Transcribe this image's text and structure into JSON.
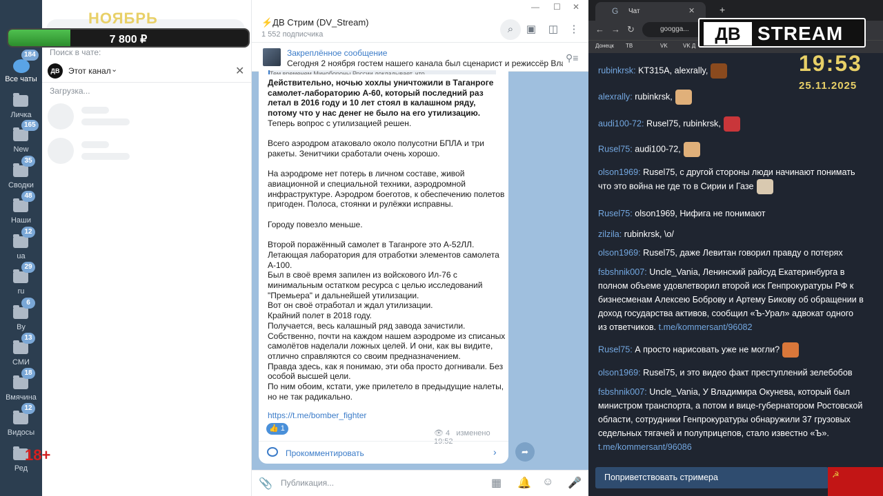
{
  "overlay": {
    "month": "НОЯБРЬ",
    "money": "7 800 ₽",
    "money_progress": 0.26,
    "age": "18+"
  },
  "rail": [
    {
      "label": "Все чаты",
      "badge": "184"
    },
    {
      "label": "Личка",
      "badge": ""
    },
    {
      "label": "New",
      "badge": "165"
    },
    {
      "label": "Сводки",
      "badge": "35"
    },
    {
      "label": "Наши",
      "badge": "48"
    },
    {
      "label": "ua",
      "badge": "12"
    },
    {
      "label": "ru",
      "badge": "29"
    },
    {
      "label": "By",
      "badge": "6"
    },
    {
      "label": "СМИ",
      "badge": "13"
    },
    {
      "label": "Вмячина",
      "badge": "18"
    },
    {
      "label": "Видосы",
      "badge": "12"
    },
    {
      "label": "Ред",
      "badge": ""
    }
  ],
  "chatlist": {
    "search_label": "Поиск в чате:",
    "channel_name": "Этот канал",
    "channel_avatar": "ДВ",
    "loading": "Загрузка..."
  },
  "header": {
    "title": "⚡ДВ Стрим (DV_Stream)",
    "subscribers": "1 552 подписчика"
  },
  "pinned": {
    "title": "Закреплённое сообщение",
    "text": "Сегодня 2 ноября гостем нашего канала был сценарист и режиссёр Вла..."
  },
  "message": {
    "reply_preview": "Тем временем Минобороны России докладывает, что ...",
    "bold": "Действительно, ночью хохлы уничтожили в Таганроге самолет-лабораторию А-60, который последний раз летал в 2016 году и 10 лет стоял в калашном ряду, потому что у нас денег не было на его утилизацию.",
    "body": "\nТеперь вопрос с утилизацией решен.\n\nВсего аэродром атаковало около полусотни БПЛА и три ракеты. Зенитчики сработали очень хорошо.\n\nНа аэродроме нет потерь в личном составе, живой авиационной и специальной техники, аэродромной инфраструктуре. Аэродром боеготов, к обеспечению полетов пригоден. Полоса, стоянки и рулёжки исправны.\n\nГороду повезло меньше.\n\nВторой поражённый самолет в Таганроге это А-52ЛЛ. Летающая лаборатория для отработки элементов самолета А-100.\nБыл в своё время запилен из войскового Ил-76 с минимальным остатком ресурса с целью исследований \"Премьера\" и дальнейшей утилизации.\nВот он своё отработал и ждал утилизации.\nКрайний полет в 2018 году.\nПолучается, весь калашный ряд завода зачистили.\nСобственно, почти на каждом нашем аэродроме из списаных самолётов наделали ложных целей. И они, как вы видите, отлично справляются со своим предназначением.\nПравда здесь, как я понимаю, эти оба просто догнивали. Без особой высшей цели.\nПо ним обоим, кстати, уже прилетело в предыдущие налеты, но не так радикально.",
    "link": "https://t.me/bomber_fighter",
    "reaction": "👍 1",
    "views": "4",
    "edited": "изменено 19:52",
    "comment": "Прокомментировать"
  },
  "composer": {
    "placeholder": "Публикация..."
  },
  "browser": {
    "tab_title": "Чат",
    "url": "googga...",
    "bookmarks": [
      "Донецк",
      "ТВ",
      "VK",
      "VK Д"
    ],
    "logo_left": "ДВ",
    "logo_right": "STREAM",
    "clock": "19:53",
    "date": "25.11.2025",
    "greet_button": "Поприветствовать стримера",
    "messages": [
      {
        "user": "rubinkrsk:",
        "text": " KT315A, alexrally,",
        "emote": "#8a4a1e"
      },
      {
        "user": "alexrally:",
        "text": " rubinkrsk,",
        "emote": "#e0b07a"
      },
      {
        "user": "audi100-72:",
        "text": " Rusel75, rubinkrsk,",
        "emote": "#c9363a"
      },
      {
        "user": "Rusel75:",
        "text": " audi100-72,",
        "emote": "#e0b07a"
      },
      {
        "user": "olson1969:",
        "text": " Rusel75, с другой стороны люди начинают понимать что это война не где то в Сирии и Газе",
        "emote": "#d9c9b0"
      },
      {
        "user": "Rusel75:",
        "text": " olson1969, Нифига не понимают",
        "emote": ""
      },
      {
        "user": "zilzila:",
        "text": " rubinkrsk, \\o/",
        "emote": ""
      },
      {
        "user": "olson1969:",
        "text": " Rusel75, даже Левитан говорил правду о потерях",
        "emote": ""
      },
      {
        "user": "fsbshnik007:",
        "text": " Uncle_Vania, Ленинский райсуд Екатеринбурга в полном объеме удовлетворил второй иск Генпрокуратуры РФ к бизнесменам Алексею Боброву и Артему Бикову об обращении в доход государства активов, сообщил «Ъ-Урал» адвокат одного из ответчиков. ",
        "link": "t.me/kommersant/96082",
        "emote": ""
      },
      {
        "user": "Rusel75:",
        "text": " А просто нарисовать уже не могли?",
        "emote": "#d9773a"
      },
      {
        "user": "olson1969:",
        "text": " Rusel75, и это видео факт преступлений зелебобов",
        "emote": ""
      },
      {
        "user": "fsbshnik007:",
        "text": " Uncle_Vania, У Владимира Окунева, который был министром транспорта, а потом и вице-губернатором Ростовской области, сотрудники Генпрокуратуры обнаружили 37 грузовых седельных тягачей и полуприцепов, стало известно «Ъ». ",
        "link": "t.me/kommersant/96086",
        "emote": ""
      }
    ]
  }
}
